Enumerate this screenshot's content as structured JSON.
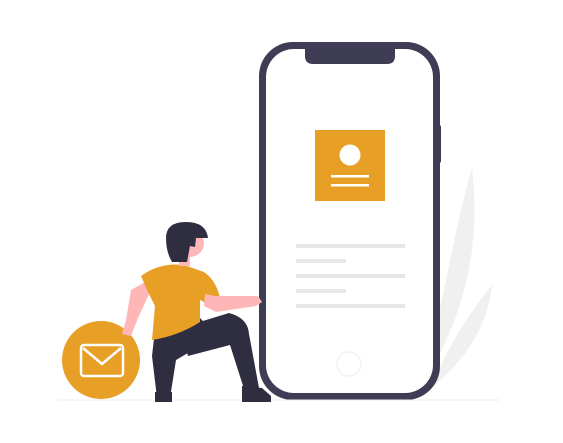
{
  "colors": {
    "accent": "#E89F25",
    "phone_frame": "#3F3D56",
    "skin": "#FFB6B6",
    "hair": "#2F2E41",
    "pants": "#2F2E41",
    "placeholder_lines": "#E6E6E6",
    "leaves": "#F0F0F0",
    "white": "#FFFFFF"
  },
  "icons": {
    "profile_card": "user-profile-icon",
    "mail_badge": "envelope-icon",
    "home_button": "home-button-icon"
  }
}
